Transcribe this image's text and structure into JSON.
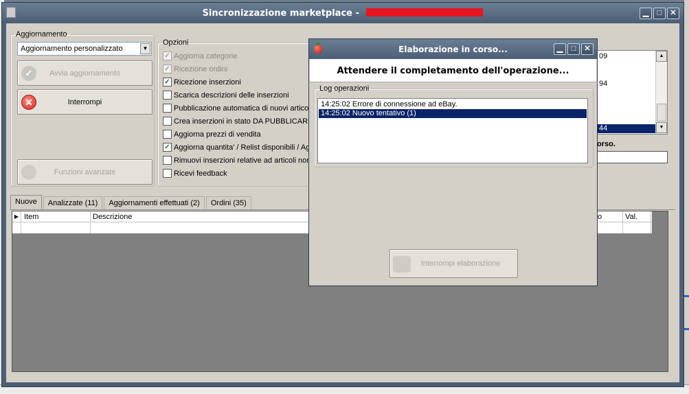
{
  "main_window": {
    "title": "Sincronizzazione marketplace - ",
    "controls": {
      "minimize": "▁",
      "maximize": "□",
      "close": "✕"
    }
  },
  "aggiornamento": {
    "legend": "Aggiornamento",
    "combo_value": "Aggiornamento personalizzato",
    "avvia_button": "Avvia aggiornamento",
    "interrompi_button": "Interrompi",
    "funzioni_button": "Funzioni avanzate"
  },
  "opzioni": {
    "legend": "Opzioni",
    "items": [
      {
        "label": "Aggiorna categorie",
        "checked": true,
        "disabled": true
      },
      {
        "label": "Ricezione ordini",
        "checked": true,
        "disabled": true
      },
      {
        "label": "Ricezione inserzioni",
        "checked": true,
        "disabled": false
      },
      {
        "label": "Scarica descrizioni delle inserzioni",
        "checked": false,
        "disabled": false
      },
      {
        "label": "Pubblicazione automatica di nuovi articoli i",
        "checked": false,
        "disabled": false
      },
      {
        "label": "Crea inserzioni in stato DA PUBBLICARE",
        "checked": false,
        "disabled": false
      },
      {
        "label": "Aggiorna prezzi di vendita",
        "checked": false,
        "disabled": false
      },
      {
        "label": "Aggiorna quantita' / Relist disponibili / Agg",
        "checked": true,
        "disabled": false
      },
      {
        "label": "Rimuovi inserzioni relative ad articoli non p",
        "checked": false,
        "disabled": false
      },
      {
        "label": "Ricevi feedback",
        "checked": false,
        "disabled": false
      }
    ]
  },
  "right_panel": {
    "values": [
      "09",
      "94",
      "44"
    ],
    "status_label": "orso."
  },
  "tabs": [
    {
      "label": "Nuove",
      "active": true
    },
    {
      "label": "Analizzate (11)",
      "active": false
    },
    {
      "label": "Aggiornamenti effettuati (2)",
      "active": false
    },
    {
      "label": "Ordini (35)",
      "active": false
    }
  ],
  "grid": {
    "row_indicator": "▶",
    "columns": [
      "Item",
      "Descrizione",
      "o",
      "Val."
    ]
  },
  "dialog": {
    "title": "Elaborazione in corso...",
    "message": "Attendere il completamento dell'operazione...",
    "log_legend": "Log operazioni",
    "log_lines": [
      {
        "text": "14:25:02 Errore di connessione ad eBay.",
        "selected": false
      },
      {
        "text": "14:25:02 Nuovo tentativo (1)",
        "selected": true
      }
    ],
    "stop_button": "Interrompi elaborazione"
  },
  "colors": {
    "titlebar": "#4b5e74",
    "window_bg": "#d4d0c8",
    "selection": "#0a246a",
    "redaction": "#e8141d",
    "check": "#1b7a1b"
  }
}
